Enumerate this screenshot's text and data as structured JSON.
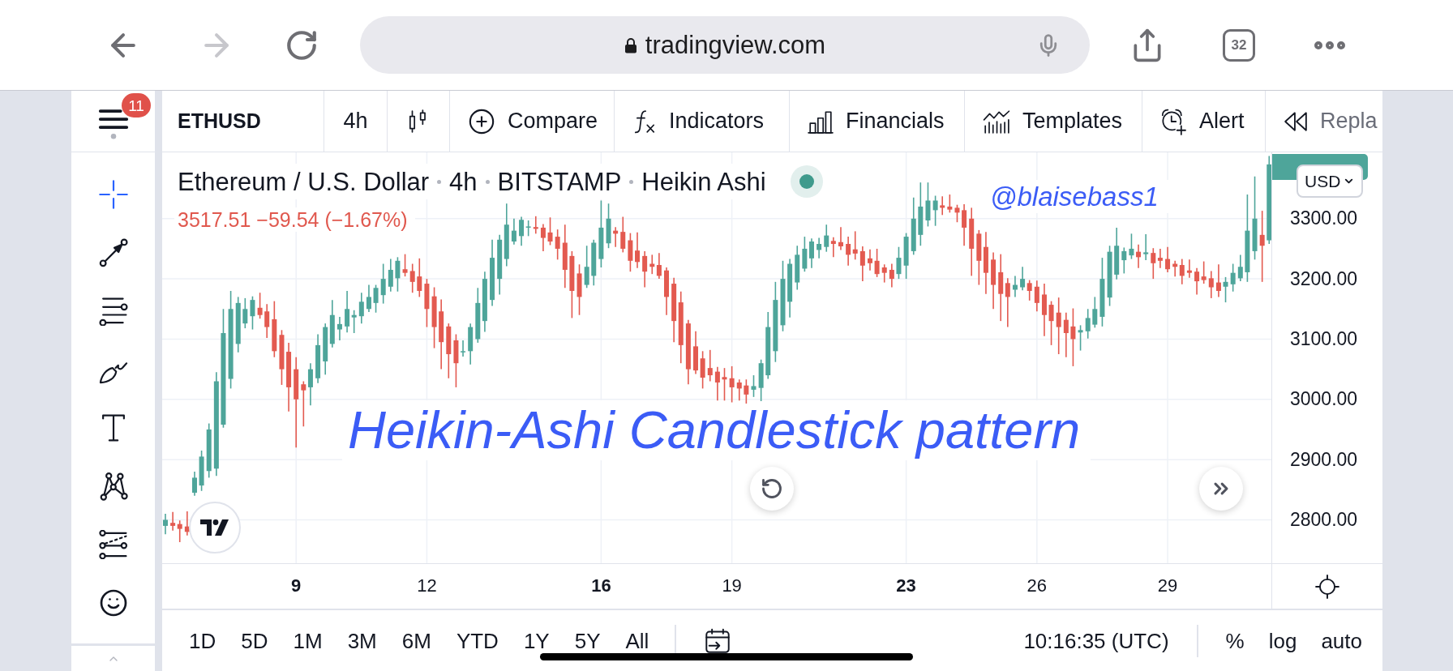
{
  "browser": {
    "back": {
      "disabled": false
    },
    "forward": {
      "disabled": true
    },
    "address": "tradingview.com",
    "tab_count": "32"
  },
  "sidebar": {
    "menu_badge": "11",
    "tools": [
      {
        "selected": true
      },
      {
        "selected": false
      },
      {
        "selected": false
      },
      {
        "selected": false
      },
      {
        "selected": false
      },
      {
        "selected": false
      },
      {
        "selected": false
      },
      {
        "selected": false
      }
    ]
  },
  "toolbar": {
    "symbol": "ETHUSD",
    "interval": "4h",
    "buttons": [
      "Compare",
      "Indicators",
      "Financials",
      "Templates",
      "Alert",
      "Repla"
    ]
  },
  "chart": {
    "legend": [
      "Ethereum / U.S. Dollar",
      "4h",
      "BITSTAMP",
      "Heikin Ashi"
    ],
    "price_change": "3517.51 −59.54 (−1.67%)",
    "annotations": [
      {
        "kind": "handle",
        "text": "@blaisebass1"
      },
      {
        "kind": "caption",
        "text": "Heikin-Ashi Candlestick pattern"
      }
    ],
    "currency": "USD",
    "time_axis_bold": [
      true,
      false,
      true,
      false,
      true,
      false,
      false
    ],
    "chart_data": {
      "type": "candlestick",
      "grid": true,
      "x": [
        6,
        6.17,
        6.33,
        6.5,
        6.67,
        6.83,
        7,
        7.17,
        7.33,
        7.5,
        7.67,
        7.83,
        8,
        8.17,
        8.33,
        8.5,
        8.67,
        8.83,
        9,
        9.17,
        9.33,
        9.5,
        9.67,
        9.83,
        10,
        10.17,
        10.33,
        10.5,
        10.67,
        10.83,
        11,
        11.17,
        11.33,
        11.5,
        11.67,
        11.83,
        12,
        12.17,
        12.33,
        12.5,
        12.67,
        12.83,
        13,
        13.17,
        13.33,
        13.5,
        13.67,
        13.83,
        14,
        14.17,
        14.33,
        14.5,
        14.67,
        14.83,
        15,
        15.17,
        15.33,
        15.5,
        15.67,
        15.83,
        16,
        16.17,
        16.33,
        16.5,
        16.67,
        16.83,
        17,
        17.17,
        17.33,
        17.5,
        17.67,
        17.83,
        18,
        18.17,
        18.33,
        18.5,
        18.67,
        18.83,
        19,
        19.17,
        19.33,
        19.5,
        19.67,
        19.83,
        20,
        20.17,
        20.33,
        20.5,
        20.67,
        20.83,
        21,
        21.17,
        21.33,
        21.5,
        21.67,
        21.83,
        22,
        22.17,
        22.33,
        22.5,
        22.67,
        22.83,
        23,
        23.17,
        23.33,
        23.5,
        23.67,
        23.83,
        24,
        24.17,
        24.33,
        24.5,
        24.67,
        24.83,
        25,
        25.17,
        25.33,
        25.5,
        25.67,
        25.83,
        26,
        26.17,
        26.33,
        26.5,
        26.67,
        26.83,
        27,
        27.17,
        27.33,
        27.5,
        27.67,
        27.83,
        28,
        28.17,
        28.33,
        28.5,
        28.67,
        28.83,
        29,
        29.17,
        29.33,
        29.5,
        29.67,
        29.83,
        30,
        30.17,
        30.33,
        30.5,
        30.67,
        30.83,
        31,
        31.17,
        31.33
      ],
      "ohlc": [
        [
          2790,
          2810,
          2776,
          2800
        ],
        [
          2795,
          2813,
          2782,
          2790
        ],
        [
          2793,
          2799,
          2763,
          2785
        ],
        [
          2789,
          2814,
          2774,
          2780
        ],
        [
          2845,
          2880,
          2840,
          2870
        ],
        [
          2857,
          2915,
          2848,
          2905
        ],
        [
          2881,
          2960,
          2870,
          2950
        ],
        [
          2885,
          3045,
          2873,
          3030
        ],
        [
          2958,
          3150,
          2953,
          3110
        ],
        [
          3034,
          3180,
          3018,
          3150
        ],
        [
          3092,
          3170,
          3078,
          3160
        ],
        [
          3126,
          3168,
          3118,
          3150
        ],
        [
          3138,
          3171,
          3116,
          3165
        ],
        [
          3152,
          3177,
          3134,
          3140
        ],
        [
          3146,
          3158,
          3102,
          3120
        ],
        [
          3133,
          3163,
          3070,
          3080
        ],
        [
          3107,
          3115,
          3024,
          3050
        ],
        [
          3079,
          3094,
          2980,
          3020
        ],
        [
          3050,
          3070,
          2920,
          3000
        ],
        [
          3025,
          3030,
          2955,
          3015
        ],
        [
          3020,
          3060,
          2990,
          3050
        ],
        [
          3035,
          3108,
          3027,
          3090
        ],
        [
          3063,
          3126,
          3041,
          3120
        ],
        [
          3092,
          3165,
          3086,
          3140
        ],
        [
          3116,
          3137,
          3098,
          3125
        ],
        [
          3121,
          3180,
          3111,
          3150
        ],
        [
          3136,
          3148,
          3110,
          3140
        ],
        [
          3138,
          3177,
          3126,
          3162
        ],
        [
          3150,
          3190,
          3145,
          3170
        ],
        [
          3160,
          3190,
          3144,
          3185
        ],
        [
          3173,
          3225,
          3159,
          3200
        ],
        [
          3187,
          3233,
          3179,
          3215
        ],
        [
          3201,
          3236,
          3179,
          3230
        ],
        [
          3216,
          3241,
          3204,
          3210
        ],
        [
          3213,
          3225,
          3177,
          3195
        ],
        [
          3204,
          3234,
          3170,
          3180
        ],
        [
          3192,
          3200,
          3120,
          3150
        ],
        [
          3171,
          3186,
          3085,
          3120
        ],
        [
          3146,
          3166,
          3050,
          3095
        ],
        [
          3121,
          3126,
          3035,
          3075
        ],
        [
          3098,
          3108,
          3020,
          3060
        ],
        [
          3079,
          3098,
          3071,
          3080
        ],
        [
          3080,
          3126,
          3058,
          3120
        ],
        [
          3100,
          3185,
          3094,
          3160
        ],
        [
          3130,
          3212,
          3112,
          3200
        ],
        [
          3165,
          3265,
          3155,
          3235
        ],
        [
          3200,
          3273,
          3174,
          3265
        ],
        [
          3233,
          3325,
          3221,
          3290
        ],
        [
          3262,
          3300,
          3257,
          3280
        ],
        [
          3271,
          3303,
          3255,
          3298
        ],
        [
          3285,
          3297,
          3271,
          3287
        ],
        [
          3286,
          3304,
          3275,
          3283
        ],
        [
          3285,
          3291,
          3246,
          3268
        ],
        [
          3277,
          3302,
          3256,
          3262
        ],
        [
          3270,
          3282,
          3232,
          3250
        ],
        [
          3260,
          3290,
          3185,
          3215
        ],
        [
          3238,
          3246,
          3135,
          3180
        ],
        [
          3209,
          3224,
          3140,
          3170
        ],
        [
          3190,
          3255,
          3185,
          3220
        ],
        [
          3205,
          3265,
          3189,
          3260
        ],
        [
          3233,
          3330,
          3219,
          3285
        ],
        [
          3259,
          3325,
          3251,
          3300
        ],
        [
          3280,
          3286,
          3253,
          3275
        ],
        [
          3278,
          3303,
          3244,
          3250
        ],
        [
          3264,
          3276,
          3212,
          3230
        ],
        [
          3247,
          3277,
          3218,
          3228
        ],
        [
          3238,
          3246,
          3186,
          3212
        ],
        [
          3225,
          3240,
          3208,
          3220
        ],
        [
          3223,
          3243,
          3200,
          3205
        ],
        [
          3214,
          3219,
          3140,
          3170
        ],
        [
          3192,
          3202,
          3095,
          3130
        ],
        [
          3161,
          3179,
          3060,
          3090
        ],
        [
          3126,
          3132,
          3025,
          3050
        ],
        [
          3088,
          3113,
          3042,
          3048
        ],
        [
          3068,
          3080,
          3018,
          3036
        ],
        [
          3052,
          3082,
          3030,
          3040
        ],
        [
          3046,
          3054,
          2998,
          3028
        ],
        [
          3037,
          3052,
          2998,
          3033
        ],
        [
          3035,
          3055,
          2995,
          3020
        ],
        [
          3028,
          3033,
          2998,
          3018
        ],
        [
          3023,
          3033,
          2993,
          3008
        ],
        [
          3016,
          3040,
          3004,
          3022
        ],
        [
          3019,
          3066,
          2997,
          3060
        ],
        [
          3040,
          3145,
          3034,
          3120
        ],
        [
          3080,
          3195,
          3062,
          3165
        ],
        [
          3123,
          3230,
          3113,
          3200
        ],
        [
          3162,
          3233,
          3136,
          3225
        ],
        [
          3194,
          3255,
          3182,
          3240
        ],
        [
          3217,
          3270,
          3212,
          3250
        ],
        [
          3234,
          3267,
          3218,
          3262
        ],
        [
          3248,
          3268,
          3234,
          3258
        ],
        [
          3253,
          3290,
          3245,
          3272
        ],
        [
          3263,
          3269,
          3236,
          3258
        ],
        [
          3261,
          3286,
          3248,
          3254
        ],
        [
          3258,
          3270,
          3222,
          3240
        ],
        [
          3249,
          3279,
          3232,
          3242
        ],
        [
          3246,
          3254,
          3196,
          3222
        ],
        [
          3234,
          3249,
          3214,
          3226
        ],
        [
          3230,
          3250,
          3203,
          3208
        ],
        [
          3219,
          3224,
          3194,
          3210
        ],
        [
          3215,
          3225,
          3186,
          3200
        ],
        [
          3208,
          3253,
          3200,
          3235
        ],
        [
          3222,
          3276,
          3200,
          3270
        ],
        [
          3246,
          3335,
          3240,
          3300
        ],
        [
          3273,
          3360,
          3255,
          3320
        ],
        [
          3297,
          3360,
          3287,
          3330
        ],
        [
          3314,
          3338,
          3288,
          3330
        ],
        [
          3322,
          3337,
          3306,
          3318
        ],
        [
          3320,
          3340,
          3310,
          3315
        ],
        [
          3318,
          3323,
          3294,
          3310
        ],
        [
          3314,
          3324,
          3255,
          3285
        ],
        [
          3300,
          3318,
          3205,
          3250
        ],
        [
          3275,
          3281,
          3190,
          3230
        ],
        [
          3253,
          3278,
          3175,
          3210
        ],
        [
          3232,
          3244,
          3150,
          3190
        ],
        [
          3211,
          3241,
          3130,
          3175
        ],
        [
          3193,
          3201,
          3120,
          3170
        ],
        [
          3182,
          3205,
          3170,
          3190
        ],
        [
          3186,
          3220,
          3181,
          3200
        ],
        [
          3193,
          3198,
          3164,
          3180
        ],
        [
          3187,
          3197,
          3146,
          3160
        ],
        [
          3174,
          3192,
          3105,
          3140
        ],
        [
          3157,
          3163,
          3090,
          3130
        ],
        [
          3144,
          3169,
          3075,
          3120
        ],
        [
          3132,
          3144,
          3070,
          3110
        ],
        [
          3121,
          3151,
          3055,
          3100
        ],
        [
          3111,
          3123,
          3081,
          3115
        ],
        [
          3113,
          3150,
          3101,
          3135
        ],
        [
          3124,
          3170,
          3119,
          3150
        ],
        [
          3137,
          3235,
          3121,
          3200
        ],
        [
          3169,
          3255,
          3155,
          3245
        ],
        [
          3207,
          3285,
          3199,
          3255
        ],
        [
          3231,
          3252,
          3209,
          3246
        ],
        [
          3239,
          3275,
          3233,
          3250
        ],
        [
          3245,
          3257,
          3218,
          3236
        ],
        [
          3241,
          3274,
          3231,
          3244
        ],
        [
          3243,
          3251,
          3200,
          3226
        ],
        [
          3235,
          3250,
          3218,
          3230
        ],
        [
          3233,
          3253,
          3211,
          3216
        ],
        [
          3225,
          3230,
          3204,
          3220
        ],
        [
          3223,
          3233,
          3191,
          3205
        ],
        [
          3214,
          3232,
          3202,
          3210
        ],
        [
          3212,
          3218,
          3174,
          3196
        ],
        [
          3204,
          3229,
          3192,
          3198
        ],
        [
          3201,
          3213,
          3168,
          3186
        ],
        [
          3194,
          3224,
          3170,
          3180
        ],
        [
          3187,
          3203,
          3161,
          3195
        ],
        [
          3191,
          3225,
          3179,
          3210
        ],
        [
          3201,
          3240,
          3196,
          3220
        ],
        [
          3211,
          3340,
          3195,
          3280
        ],
        [
          3246,
          3370,
          3232,
          3300
        ],
        [
          3273,
          3313,
          3195,
          3255
        ],
        [
          3264,
          3404,
          3258,
          3390
        ]
      ],
      "xlim": [
        5.926,
        33.93
      ],
      "ylim": [
        2728,
        3410
      ],
      "xticks": [
        {
          "value": 9,
          "label": "9"
        },
        {
          "value": 12,
          "label": "12"
        },
        {
          "value": 16,
          "label": "16"
        },
        {
          "value": 19,
          "label": "19"
        },
        {
          "value": 23,
          "label": "23"
        },
        {
          "value": 26,
          "label": "26"
        },
        {
          "value": 29,
          "label": "29"
        }
      ],
      "yticks": [
        {
          "value": 3300,
          "label": "3300.00"
        },
        {
          "value": 3200,
          "label": "3200.00"
        },
        {
          "value": 3100,
          "label": "3100.00"
        },
        {
          "value": 3000,
          "label": "3000.00"
        },
        {
          "value": 2900,
          "label": "2900.00"
        },
        {
          "value": 2800,
          "label": "2800.00"
        }
      ]
    }
  },
  "bottom_bar": {
    "ranges": [
      "1D",
      "5D",
      "1M",
      "3M",
      "6M",
      "YTD",
      "1Y",
      "5Y",
      "All"
    ],
    "clock": "10:16:35 (UTC)",
    "scale_options": [
      "%",
      "log",
      "auto"
    ]
  }
}
